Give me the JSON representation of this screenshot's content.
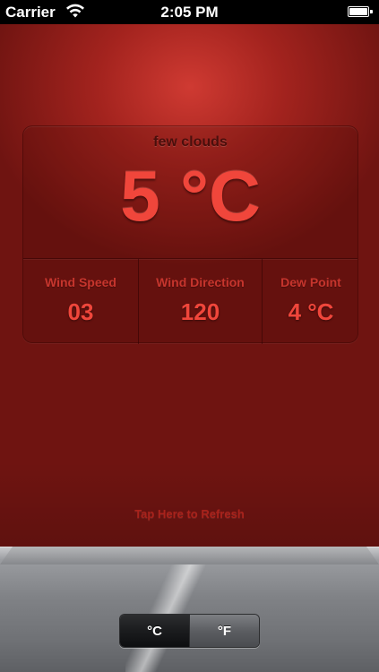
{
  "status_bar": {
    "carrier": "Carrier",
    "time": "2:05 PM",
    "wifi_icon": "wifi-icon",
    "battery_icon": "battery-icon"
  },
  "weather": {
    "condition": "few clouds",
    "temperature": "5 °C",
    "stats": [
      {
        "label": "Wind Speed",
        "value": "03"
      },
      {
        "label": "Wind Direction",
        "value": "120"
      },
      {
        "label": "Dew Point",
        "value": "4 °C"
      }
    ]
  },
  "refresh_label": "Tap Here to Refresh",
  "unit_toggle": {
    "options": [
      "°C",
      "°F"
    ],
    "selected": "°C"
  },
  "colors": {
    "background_red": "#a3231e",
    "accent_red": "#f0463b",
    "label_red": "#d83c33",
    "status_bar": "#000000",
    "tray_metal": "#808286"
  }
}
